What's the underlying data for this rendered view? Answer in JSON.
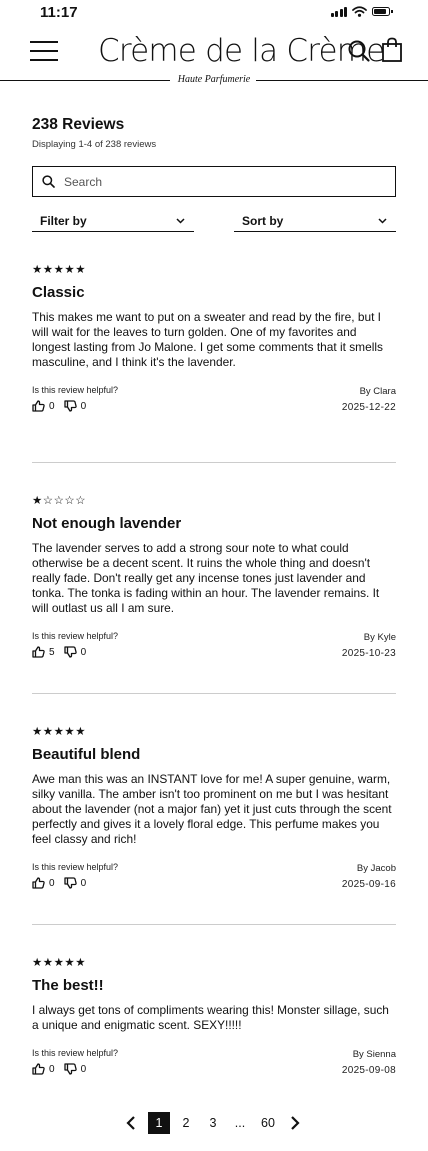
{
  "status": {
    "time": "11:17"
  },
  "brand": {
    "name": "Crème de la Crème",
    "tagline": "Haute Parfumerie"
  },
  "reviews_header": {
    "title": "238 Reviews",
    "count_text": "Displaying 1-4 of 238 reviews",
    "search_placeholder": "Search",
    "filter_label": "Filter by",
    "sort_label": "Sort by"
  },
  "helpful_label": "Is this review helpful?",
  "reviews": [
    {
      "rating": 5,
      "stars": "★★★★★",
      "title": "Classic",
      "body": "This makes me want to put on a sweater and read by the fire, but I will wait for the leaves to turn golden. One of my favorites and longest lasting from Jo Malone. I get some comments that it smells masculine, and I think it's the lavender.",
      "author": "By Clara",
      "date": "2025-12-22",
      "likes": "0",
      "dislikes": "0"
    },
    {
      "rating": 1,
      "stars": "★☆☆☆☆",
      "title": "Not enough lavender",
      "body": "The lavender serves to add a strong sour note to what could otherwise be a decent scent. It ruins the whole thing and doesn't really fade. Don't really get any incense tones just lavender and tonka. The tonka is fading within an hour. The lavender remains. It will outlast us all I am sure.",
      "author": "By Kyle",
      "date": "2025-10-23",
      "likes": "5",
      "dislikes": "0"
    },
    {
      "rating": 5,
      "stars": "★★★★★",
      "title": "Beautiful blend",
      "body": "Awe man this was an INSTANT love for me! A super genuine, warm, silky vanilla. The amber isn't too prominent on me but I was hesitant about the lavender (not a major fan) yet it just cuts through the scent perfectly and gives it a lovely floral edge. This perfume makes you feel classy and rich!",
      "author": "By Jacob",
      "date": "2025-09-16",
      "likes": "0",
      "dislikes": "0"
    },
    {
      "rating": 5,
      "stars": "★★★★★",
      "title": "The best!!",
      "body": "I always get tons of compliments wearing this! Monster sillage, such a unique and enigmatic scent. SEXY!!!!!",
      "author": "By Sienna",
      "date": "2025-09-08",
      "likes": "0",
      "dislikes": "0"
    }
  ],
  "pagination": {
    "pages": [
      "1",
      "2",
      "3",
      "...",
      "60"
    ],
    "current": "1"
  },
  "icons": [
    "menu-icon",
    "search-icon",
    "shopping-bag-icon",
    "chevron-down-icon",
    "thumbs-up-icon",
    "thumbs-down-icon",
    "chevron-left-icon",
    "chevron-right-icon"
  ]
}
